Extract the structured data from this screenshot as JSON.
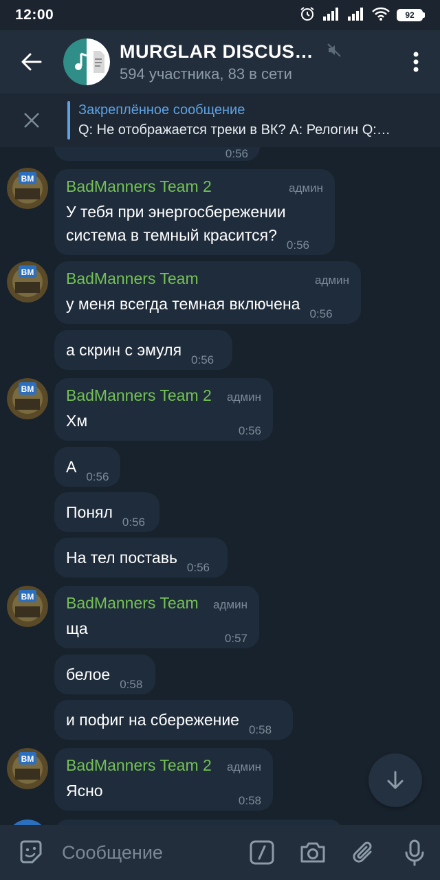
{
  "status_bar": {
    "time": "12:00",
    "battery": "92"
  },
  "header": {
    "title": "MURGLAR DISCUSS…",
    "subtitle": "594 участника, 83 в сети"
  },
  "pinned": {
    "title": "Закреплённое сообщение",
    "text": "Q: Не отображается треки в ВК? A: Релогин  Q:…"
  },
  "partial_top_time": "0:56",
  "messages": [
    {
      "sender": "BadManners Team 2",
      "role": "админ",
      "lines": [
        "У тебя при энергосбережении",
        "система в темный красится?"
      ],
      "time": "0:56"
    },
    {
      "sender": "BadManners Team",
      "role": "админ",
      "lines": [
        "у меня всегда темная включена"
      ],
      "time": "0:56"
    },
    {
      "lines": [
        "а скрин с эмуля"
      ],
      "time": "0:56"
    },
    {
      "sender": "BadManners Team 2",
      "role": "админ",
      "lines": [
        "Хм"
      ],
      "time": "0:56"
    },
    {
      "lines": [
        "А"
      ],
      "time": "0:56"
    },
    {
      "lines": [
        "Понял"
      ],
      "time": "0:56"
    },
    {
      "lines": [
        "На тел поставь"
      ],
      "time": "0:56"
    },
    {
      "sender": "BadManners Team",
      "role": "админ",
      "lines": [
        "ща"
      ],
      "time": "0:57"
    },
    {
      "lines": [
        "белое"
      ],
      "time": "0:58"
    },
    {
      "lines": [
        "и пофиг на сбережение"
      ],
      "time": "0:58"
    },
    {
      "sender": "BadManners Team 2",
      "role": "админ",
      "lines": [
        "Ясно"
      ],
      "time": "0:58"
    }
  ],
  "composer": {
    "placeholder": "Сообщение"
  },
  "colors": {
    "accent": "#5ea2e4",
    "sender": "#73c154",
    "bubble": "#1f2c3b",
    "background": "#18222d"
  }
}
